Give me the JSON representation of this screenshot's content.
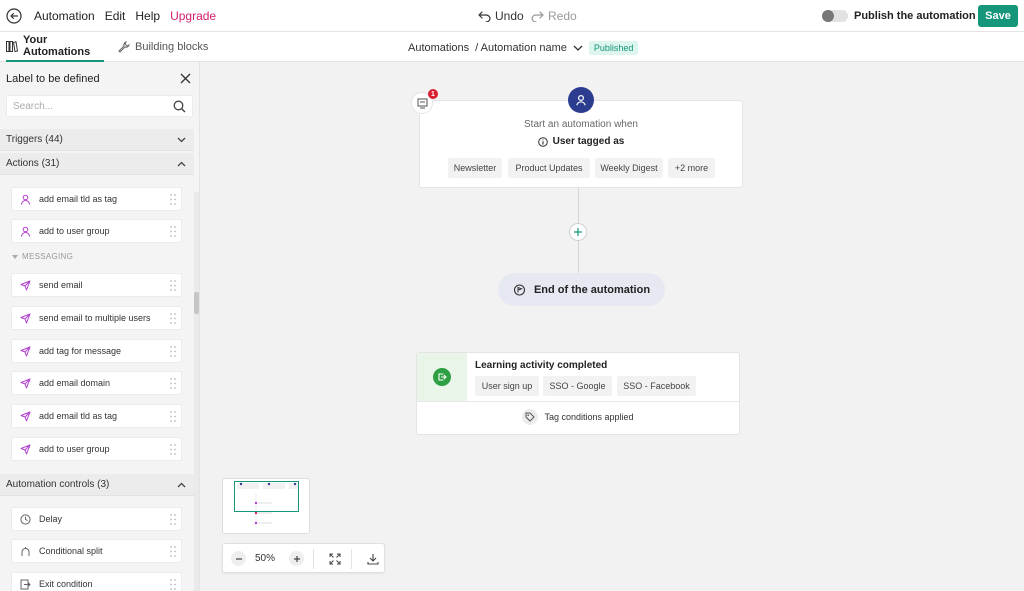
{
  "topbar": {
    "menu": [
      "Automation",
      "Edit",
      "Help"
    ],
    "upgrade": "Upgrade",
    "undo": "Undo",
    "redo": "Redo",
    "publish_label": "Publish the automation",
    "save": "Save"
  },
  "subbar": {
    "tabs": [
      "Your Automations",
      "Building blocks"
    ],
    "breadcrumb_root": "Automations",
    "breadcrumb_name": "/ Automation name",
    "status_badge": "Published"
  },
  "sidebar": {
    "header": "Label to be defined",
    "search_placeholder": "Search...",
    "sections": {
      "triggers": "Triggers (44)",
      "actions": "Actions (31)",
      "controls": "Automation controls (3)"
    },
    "actions_items": [
      "add email tld as tag",
      "add to user group"
    ],
    "messaging_label": "MESSAGING",
    "messaging_items": [
      "send email",
      "send email to multiple users",
      "add tag for message",
      "add email domain",
      "add email tld as tag",
      "add to user group"
    ],
    "control_items": [
      "Delay",
      "Conditional split",
      "Exit condition"
    ]
  },
  "canvas": {
    "trigger": {
      "notification_count": "1",
      "start_text": "Start an automation when",
      "event": "User tagged as",
      "tags": [
        "Newsletter",
        "Product Updates",
        "Weekly Digest",
        "+2 more"
      ]
    },
    "end_label": "End of the automation",
    "exit_card": {
      "title": "Learning activity completed",
      "chips": [
        "User sign up",
        "SSO - Google",
        "SSO - Facebook"
      ],
      "conditions": "Tag conditions applied"
    },
    "zoom": "50%"
  },
  "colors": {
    "brand": "#16967a",
    "upgrade": "#d4206f",
    "action_icon": "#b13fd0",
    "trigger_icon": "#2c3d8f",
    "exit_icon": "#2ea043",
    "badge_red": "#d92030"
  }
}
